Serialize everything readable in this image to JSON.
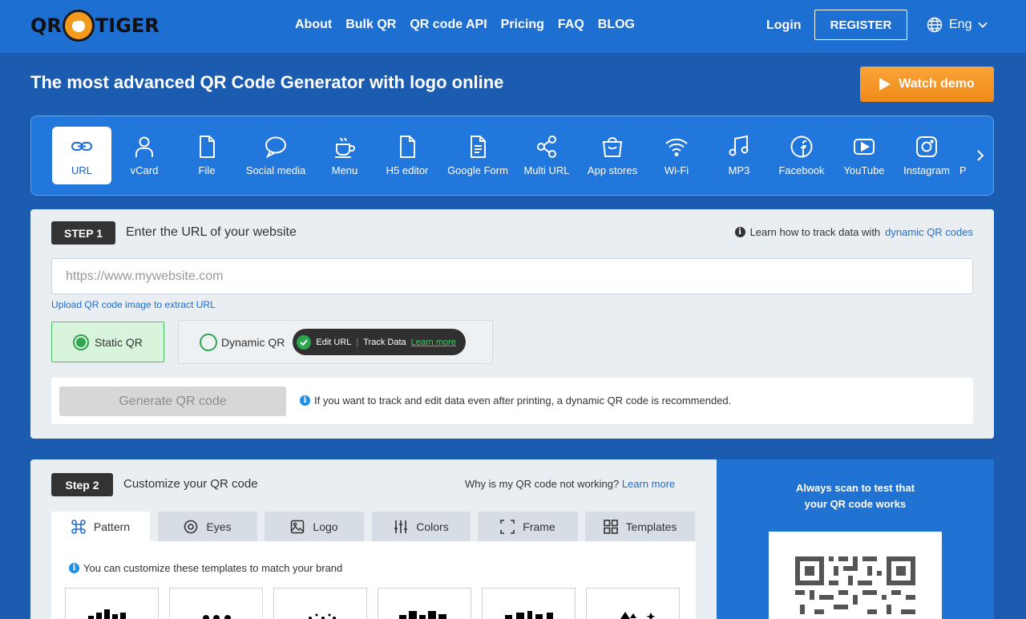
{
  "nav": {
    "logo_left": "QR",
    "logo_right": "TIGER",
    "links": [
      "About",
      "Bulk QR",
      "QR code API",
      "Pricing",
      "FAQ",
      "BLOG"
    ],
    "login": "Login",
    "register": "REGISTER",
    "language": "Eng"
  },
  "headline": "The most advanced QR Code Generator with logo online",
  "watch_demo": "Watch demo",
  "qr_types": [
    "URL",
    "vCard",
    "File",
    "Social media",
    "Menu",
    "H5 editor",
    "Google Form",
    "Multi URL",
    "App stores",
    "Wi-Fi",
    "MP3",
    "Facebook",
    "YouTube",
    "Instagram",
    "P"
  ],
  "step1": {
    "badge": "STEP 1",
    "title": "Enter the URL of your website",
    "learn_text": "Learn how to track data with",
    "learn_link": "dynamic QR codes",
    "url_placeholder": "https://www.mywebsite.com",
    "upload_link": "Upload QR code image to extract URL",
    "static_label": "Static QR",
    "dynamic_label": "Dynamic QR",
    "pill_edit": "Edit URL",
    "pill_track": "Track Data",
    "pill_learn": "Learn more",
    "generate": "Generate QR code",
    "note": "If you want to track and edit data even after printing, a dynamic QR code is recommended."
  },
  "step2": {
    "badge": "Step 2",
    "title": "Customize your QR code",
    "help_text": "Why is my QR code not working?",
    "help_link": "Learn more",
    "tabs": [
      "Pattern",
      "Eyes",
      "Logo",
      "Colors",
      "Frame",
      "Templates"
    ],
    "templates_note": "You can customize these templates to match your brand"
  },
  "preview": {
    "line1": "Always scan to test that",
    "line2": "your QR code works"
  },
  "colors": {
    "nav": "#1d6fd1",
    "background": "#1c5cb0",
    "accent_orange": "#f39a1f",
    "success_green": "#2ea44f",
    "link_blue": "#1f6cd0"
  }
}
